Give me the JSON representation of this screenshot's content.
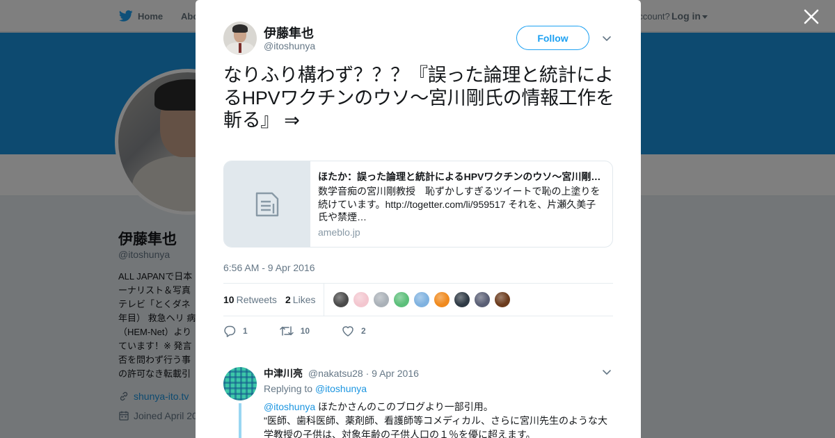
{
  "nav": {
    "home_label": "Home",
    "about_label": "Abo",
    "account_text": "account?",
    "login_label": "Log in"
  },
  "profile": {
    "name": "伊藤隼也",
    "handle": "@itoshunya",
    "bio": "ALL JAPANで日本ーナリスト＆写真テレビ「とくダネ年目） 救急ヘリ 病（HEM-Net）よりています！※ 発言否を問わず行う事の許可なき転載引",
    "website": "shunya-ito.tv",
    "joined": "Joined April 20"
  },
  "tweet": {
    "author_name": "伊藤隼也",
    "author_handle": "@itoshunya",
    "follow_label": "Follow",
    "text": "なりふり構わず？？？『誤った論理と統計によるHPVワクチンのウソ～宮川剛氏の情報工作を斬る』 ⇒",
    "card": {
      "title": "ほたか：誤った論理と統計によるHPVワクチンのウソ～宮川剛氏の情報工作を斬る",
      "description": "数学音痴の宮川剛教授　恥ずかしすぎるツイートで恥の上塗りを続けています。http://togetter.com/li/959517 それを、片瀬久美子氏や禁煙…",
      "domain": "ameblo.jp"
    },
    "timestamp": "6:56 AM - 9 Apr 2016",
    "retweets_count": "10",
    "retweets_label": "Retweets",
    "likes_count": "2",
    "likes_label": "Likes",
    "actions": {
      "reply_count": "1",
      "retweet_count": "10",
      "like_count": "2"
    },
    "liker_colors": [
      "#4a4a4a",
      "#f3c6cf",
      "#aab1b8",
      "#5cbf7a",
      "#7fb2e0",
      "#f08a1e",
      "#2f3a45",
      "#5a5f75",
      "#6b3b1d"
    ]
  },
  "reply": {
    "name": "中津川亮",
    "handle": "@nakatsu28",
    "date": "· 9 Apr 2016",
    "replying_prefix": "Replying to",
    "replying_to": "@itoshunya",
    "mention": "@itoshunya",
    "body_first": " ほたかさんのこのブログより一部引用。",
    "body_rest": "\"医師、歯科医師、薬剤師、看護師等コメディカル、さらに宮川先生のような大学教授の子供は、対象年齢の子供人口の１％を優に超えます。"
  },
  "icons": {
    "bird": "twitter-bird-icon",
    "close": "close-icon",
    "chevron": "chevron-down-icon",
    "doc": "document-icon",
    "reply": "reply-icon",
    "retweet": "retweet-icon",
    "like": "heart-icon",
    "link": "link-icon",
    "calendar": "calendar-icon"
  },
  "colors": {
    "brand_blue": "#1da1f2",
    "banner_blue": "#1b95e0",
    "link_blue": "#1b95e0",
    "muted_text": "#657786"
  }
}
